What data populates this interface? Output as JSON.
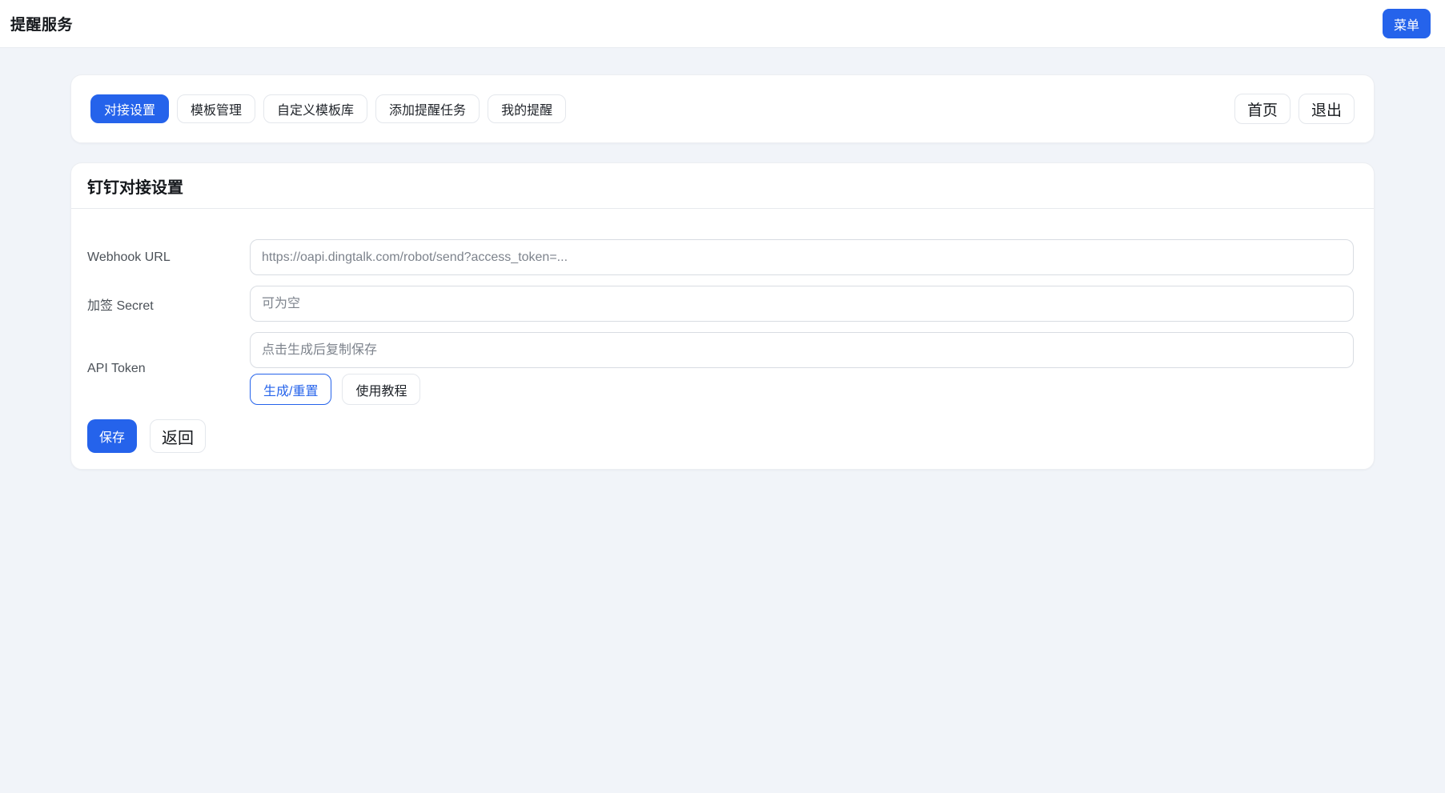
{
  "header": {
    "title": "提醒服务",
    "menu_button": "菜单"
  },
  "nav": {
    "tabs": [
      {
        "label": "对接设置",
        "active": true
      },
      {
        "label": "模板管理",
        "active": false
      },
      {
        "label": "自定义模板库",
        "active": false
      },
      {
        "label": "添加提醒任务",
        "active": false
      },
      {
        "label": "我的提醒",
        "active": false
      }
    ],
    "home_button": "首页",
    "exit_button": "退出"
  },
  "panel": {
    "title": "钉钉对接设置",
    "fields": [
      {
        "label": "Webhook URL",
        "placeholder": "https://oapi.dingtalk.com/robot/send?access_token=...",
        "value": ""
      },
      {
        "label": "加签 Secret",
        "placeholder": "可为空",
        "value": ""
      },
      {
        "label": "API Token",
        "placeholder": "点击生成后复制保存",
        "value": ""
      }
    ],
    "generate_button": "生成/重置",
    "tutorial_button": "使用教程",
    "save_button": "保存",
    "back_button": "返回"
  },
  "colors": {
    "accent_blue": "#2563eb",
    "page_background": "#f1f4f9",
    "card_background": "#ffffff",
    "input_border": "#d8dce2",
    "divider": "#e7eaee"
  }
}
